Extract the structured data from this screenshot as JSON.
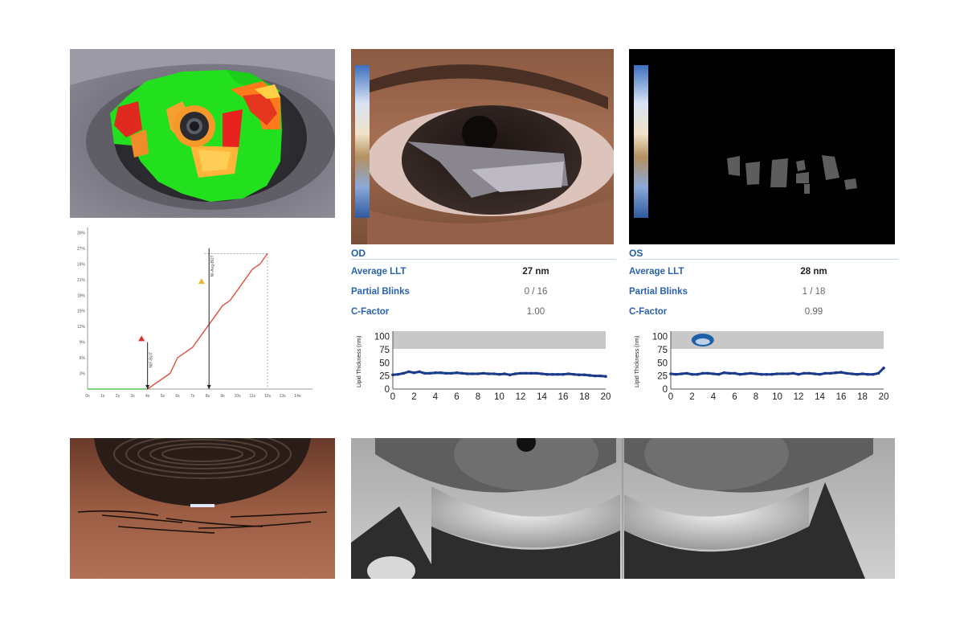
{
  "od": {
    "header": "OD",
    "rows": [
      {
        "label": "Average LLT",
        "value": "27 nm"
      },
      {
        "label": "Partial Blinks",
        "value": "0 / 16"
      },
      {
        "label": "C-Factor",
        "value": "1.00"
      }
    ],
    "chart_data": {
      "type": "line",
      "ylabel": "Lipid Thickness (nm)",
      "yticks": [
        "100",
        "75",
        "50",
        "25",
        "0"
      ],
      "xticks": [
        "0",
        "2",
        "4",
        "6",
        "8",
        "10",
        "12",
        "14",
        "16",
        "18",
        "20"
      ],
      "xlim": [
        0,
        20
      ],
      "ylim": [
        0,
        110
      ],
      "x": [
        0,
        0.5,
        1,
        1.5,
        2,
        2.5,
        3,
        3.5,
        4,
        4.5,
        5,
        5.5,
        6,
        6.5,
        7,
        7.5,
        8,
        8.5,
        9,
        9.5,
        10,
        10.5,
        11,
        11.5,
        12,
        12.5,
        13,
        13.5,
        14,
        14.5,
        15,
        15.5,
        16,
        16.5,
        17,
        17.5,
        18,
        18.5,
        19,
        19.5,
        20
      ],
      "y": [
        27,
        28,
        30,
        33,
        31,
        33,
        30,
        30,
        31,
        31,
        30,
        30,
        31,
        30,
        29,
        29,
        29,
        30,
        29,
        29,
        28,
        29,
        27,
        29,
        30,
        30,
        30,
        30,
        29,
        28,
        28,
        28,
        28,
        29,
        28,
        27,
        27,
        26,
        25,
        25,
        24
      ]
    }
  },
  "os": {
    "header": "OS",
    "rows": [
      {
        "label": "Average LLT",
        "value": "28 nm"
      },
      {
        "label": "Partial Blinks",
        "value": "1 / 18"
      },
      {
        "label": "C-Factor",
        "value": "0.99"
      }
    ],
    "chart_data": {
      "type": "line",
      "ylabel": "Lipid Thickness (nm)",
      "yticks": [
        "100",
        "75",
        "50",
        "25",
        "0"
      ],
      "xticks": [
        "0",
        "2",
        "4",
        "6",
        "8",
        "10",
        "12",
        "14",
        "16",
        "18",
        "20"
      ],
      "xlim": [
        0,
        20
      ],
      "ylim": [
        0,
        110
      ],
      "x": [
        0,
        0.5,
        1,
        1.5,
        2,
        2.5,
        3,
        3.5,
        4,
        4.5,
        5,
        5.5,
        6,
        6.5,
        7,
        7.5,
        8,
        8.5,
        9,
        9.5,
        10,
        10.5,
        11,
        11.5,
        12,
        12.5,
        13,
        13.5,
        14,
        14.5,
        15,
        15.5,
        16,
        16.5,
        17,
        17.5,
        18,
        18.5,
        19,
        19.5,
        20
      ],
      "y": [
        29,
        28,
        29,
        30,
        28,
        28,
        30,
        30,
        29,
        28,
        31,
        30,
        30,
        28,
        29,
        30,
        29,
        28,
        28,
        28,
        29,
        29,
        29,
        30,
        28,
        30,
        30,
        29,
        28,
        30,
        30,
        31,
        32,
        30,
        29,
        28,
        29,
        28,
        28,
        30,
        40
      ],
      "partial_blink_at": 3
    }
  },
  "nibut_chart": {
    "chart_data": {
      "type": "line",
      "xticks": [
        "0s",
        "1s",
        "2s",
        "3s",
        "4s",
        "5s",
        "6s",
        "7s",
        "8s",
        "9s",
        "10s",
        "11s",
        "12s",
        "13s",
        "14s"
      ],
      "yticks": [
        "30%",
        "27%",
        "24%",
        "21%",
        "18%",
        "15%",
        "12%",
        "9%",
        "6%",
        "3%"
      ],
      "xlim": [
        0,
        15
      ],
      "ylim": [
        0,
        31
      ],
      "x": [
        0,
        4,
        4.5,
        5,
        5.5,
        6,
        6.5,
        7,
        7.5,
        8,
        8.5,
        9,
        9.5,
        10,
        10.5,
        11,
        11.5,
        12
      ],
      "y": [
        0,
        0,
        1,
        2,
        3,
        6,
        7,
        8,
        10,
        12,
        14,
        16,
        17,
        19,
        21,
        23,
        24,
        26
      ],
      "markers": [
        {
          "x": 4,
          "label": "NIF-BUT"
        },
        {
          "x": 8.1,
          "label": "NI-Avg-BUT"
        }
      ],
      "end_point": {
        "x": 12,
        "y": 26
      }
    },
    "colors": {
      "curve": "#e05040",
      "baseline": "#5fbf5f",
      "warn_red": "#d9342b",
      "warn_yellow": "#e8b62a"
    }
  },
  "colors": {
    "accent_blue": "#1f5fa8",
    "plot_blue": "#1a3a8a",
    "grey_band": "#c8c8c8"
  },
  "icons": {
    "eye": "eye-icon"
  }
}
